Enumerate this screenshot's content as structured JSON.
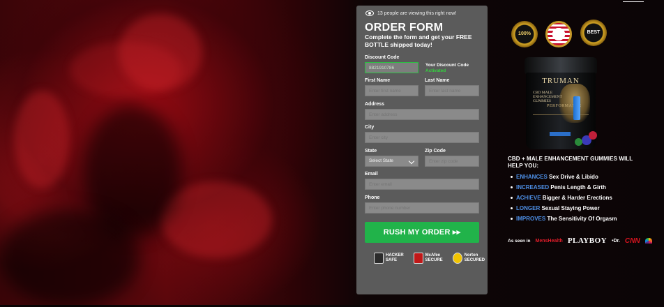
{
  "viewing": {
    "text": "13 people are viewing this right now!"
  },
  "form": {
    "title": "ORDER FORM",
    "subtitle": "Complete the form and get your FREE BOTTLE shipped today!",
    "discount": {
      "label": "Discount Code",
      "value": "8821910786",
      "note_line1": "Your Discount Code",
      "note_line2": "Activated"
    },
    "first_name": {
      "label": "First Name",
      "placeholder": "Enter first name"
    },
    "last_name": {
      "label": "Last Name",
      "placeholder": "Enter last name"
    },
    "address": {
      "label": "Address",
      "placeholder": "Enter address"
    },
    "city": {
      "label": "City",
      "placeholder": "Enter city"
    },
    "state": {
      "label": "State",
      "selected": "Select State"
    },
    "zip": {
      "label": "Zip Code",
      "placeholder": "Enter zip code"
    },
    "email": {
      "label": "Email",
      "placeholder": "Enter email"
    },
    "phone": {
      "label": "Phone",
      "placeholder": "Enter phone number"
    },
    "submit_label": "RUSH MY ORDER ▸▸",
    "badges": [
      {
        "name": "hacker-safe",
        "line1": "HACKER",
        "line2": "SAFE"
      },
      {
        "name": "mcafee-secure",
        "line1": "McAfee",
        "line2": "SECURE"
      },
      {
        "name": "norton-secured",
        "line1": "Norton",
        "line2": "SECURED"
      }
    ]
  },
  "product": {
    "seals": [
      {
        "name": "guarantee-seal",
        "text": "100%"
      },
      {
        "name": "made-in-usa-seal",
        "text": ""
      },
      {
        "name": "best-quality-seal",
        "text": "BEST"
      }
    ],
    "brand": "TRUMAN",
    "jar_subtitle": "CBD MALE ENHANCEMENT GUMMIES",
    "jar_label": "PERFORMANCE",
    "headline_line1": "CBD + MALE ENHANCEMENT GUMMIES WILL",
    "headline_line2": "HELP YOU:",
    "benefits": [
      {
        "keyword": "ENHANCES",
        "text": "Sex Drive & Libido"
      },
      {
        "keyword": "INCREASED",
        "text": "Penis Length & Girth"
      },
      {
        "keyword": "ACHIEVE",
        "text": "Bigger & Harder Erections"
      },
      {
        "keyword": "LONGER",
        "text": "Sexual Staying Power"
      },
      {
        "keyword": "IMPROVES",
        "text": "The Sensitivity Of Orgasm"
      }
    ],
    "as_seen_in": "As seen in",
    "media": {
      "mens_health": "MensHealth",
      "playboy": "PLAYBOY",
      "dr": "•Dr.",
      "cnn": "CNN"
    }
  },
  "colors": {
    "panel": "#5b5b5b",
    "submit": "#21b34a",
    "accent_blue": "#4d8fe6",
    "activated": "#34d13f"
  }
}
